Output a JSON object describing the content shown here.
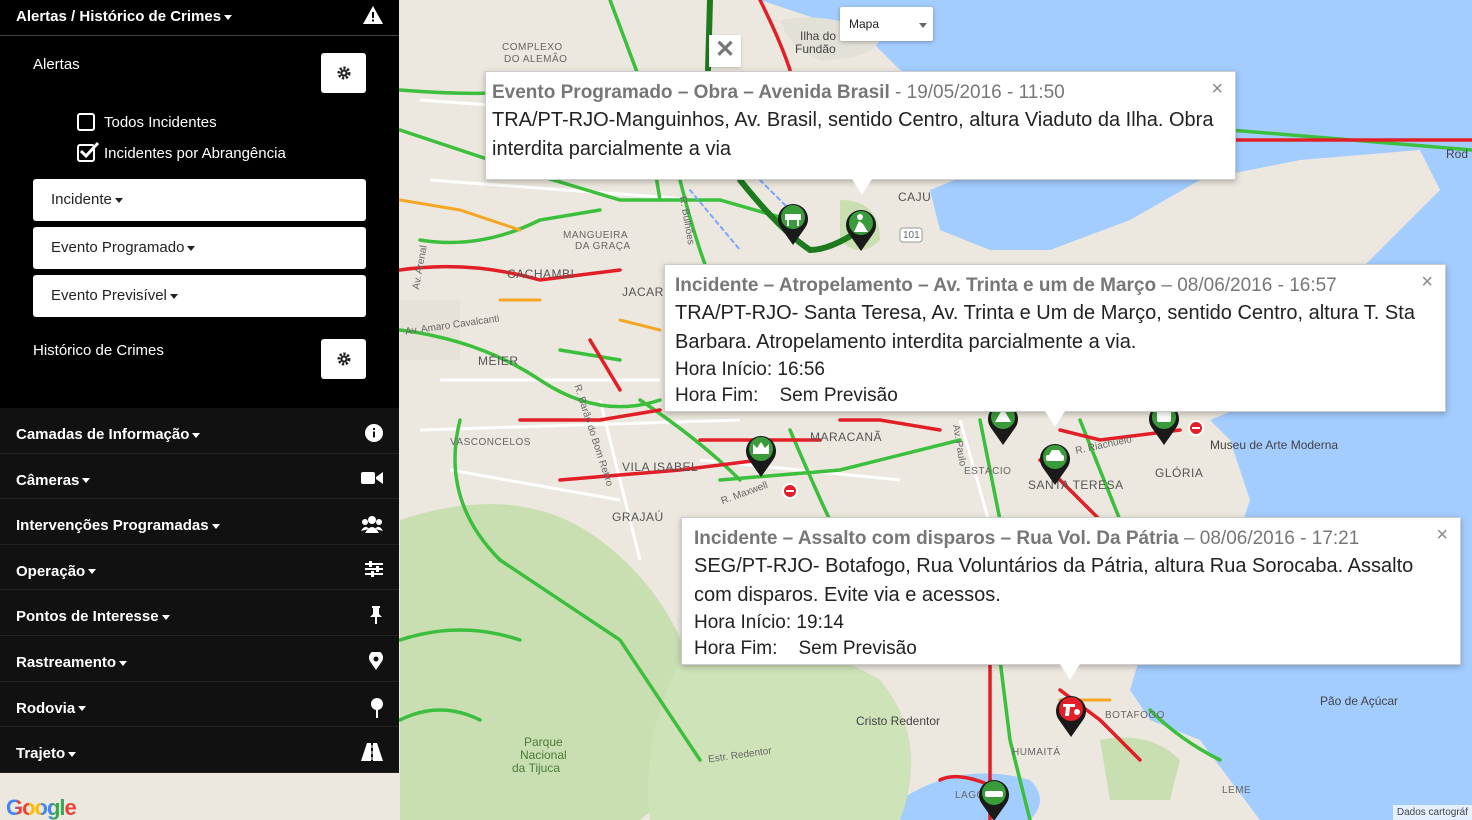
{
  "sidebar": {
    "header_title": "Alertas / Histórico de Crimes",
    "alertas_label": "Alertas",
    "checkbox_todos": "Todos Incidentes",
    "checkbox_abrangencia": "Incidentes por Abrangência",
    "dropdown_incidente": "Incidente",
    "dropdown_evento_programado": "Evento Programado",
    "dropdown_evento_previsivel": "Evento Previsível",
    "historico_label": "Histórico de Crimes",
    "menu": [
      {
        "label": "Camadas de Informação",
        "icon": "info-icon"
      },
      {
        "label": "Câmeras",
        "icon": "video-camera-icon"
      },
      {
        "label": "Intervenções Programadas",
        "icon": "users-icon"
      },
      {
        "label": "Operação",
        "icon": "sliders-icon"
      },
      {
        "label": "Pontos de Interesse",
        "icon": "pushpin-icon"
      },
      {
        "label": "Rastreamento",
        "icon": "location-pin-icon"
      },
      {
        "label": "Rodovia",
        "icon": "map-pin-icon"
      },
      {
        "label": "Trajeto",
        "icon": "road-icon"
      }
    ]
  },
  "map": {
    "map_type": "Mapa",
    "close_glyph": "✕",
    "places": {
      "complexo": "COMPLEXO",
      "do_alemao": "DO ALEMÃO",
      "ilha_do": "Ilha do",
      "fundao": "Fundão",
      "caju": "CAJU",
      "mangueira_1": "MANGUEIRA",
      "mangueira_2": "DA GRAÇA",
      "cachambi": "CACHAMBI",
      "jacare": "JACARÉ",
      "meier": "MÉIER",
      "vasconcelos": "VASCONCELOS",
      "vila_isabel": "VILA ISABEL",
      "maracana": "MARACANÃ",
      "estacio": "ESTÁCIO",
      "santa_teresa": "SANTA TERESA",
      "gloria": "GLÓRIA",
      "grajau": "GRAJAÚ",
      "botafogo": "BOTAFOGO",
      "humaita": "HUMAITÁ",
      "leme": "LEME",
      "lagoa": "LAGO",
      "parque_1": "Parque",
      "parque_2": "Nacional",
      "parque_3": "da Tijuca",
      "cristo": "Cristo Redentor",
      "pao_de_acucar": "Pão de Açúcar",
      "museu": "Museu de Arte Moderna",
      "rod": "Rod",
      "route_101": "101",
      "st_amaro": "Av. Amaro Cavalcanti",
      "st_maxwell": "R. Maxwell",
      "st_riachuelo": "R. Riachuelo",
      "st_paulo": "Av. Paulo",
      "st_estr_redentor": "Estr. Redentor",
      "st_bom_retiro": "R. Barão do Bom Retiro",
      "st_bulhoes": "R. Bulhões",
      "st_arenas": "Av. Arenal"
    },
    "google": "Google",
    "mapdata": "Dados cartográf"
  },
  "infowindows": [
    {
      "title": "Evento Programado – Obra – Avenida Brasil",
      "datetime": "- 19/05/2016 - 11:50",
      "body": "TRA/PT-RJO-Manguinhos, Av. Brasil, sentido Centro, altura Viaduto da Ilha. Obra interdita parcialmente a via"
    },
    {
      "title": "Incidente – Atropelamento – Av. Trinta e um de Março",
      "datetime": "– 08/06/2016 - 16:57",
      "body": "TRA/PT-RJO- Santa Teresa, Av. Trinta e Um de Março, sentido Centro, altura T. Sta Barbara. Atropelamento interdita parcialmente a via.",
      "start": "Hora Início: 16:56",
      "end": "Hora Fim:    Sem Previsão"
    },
    {
      "title": "Incidente – Assalto com disparos – Rua Vol. Da Pátria",
      "datetime": "– 08/06/2016 - 17:21",
      "body": "SEG/PT-RJO- Botafogo, Rua Voluntários da Pátria, altura Rua Sorocaba. Assalto com disparos. Evite via e acessos.",
      "start": "Hora Início: 19:14",
      "end": "Hora Fim:    Sem Previsão"
    }
  ],
  "colors": {
    "sidebar_bg": "#000000",
    "traffic_green": "#3cbf3c",
    "traffic_red": "#e21f26",
    "traffic_orange": "#f5a623",
    "water": "#a3ccff",
    "marker_green": "#3a9b3a",
    "marker_red": "#e21f26"
  }
}
